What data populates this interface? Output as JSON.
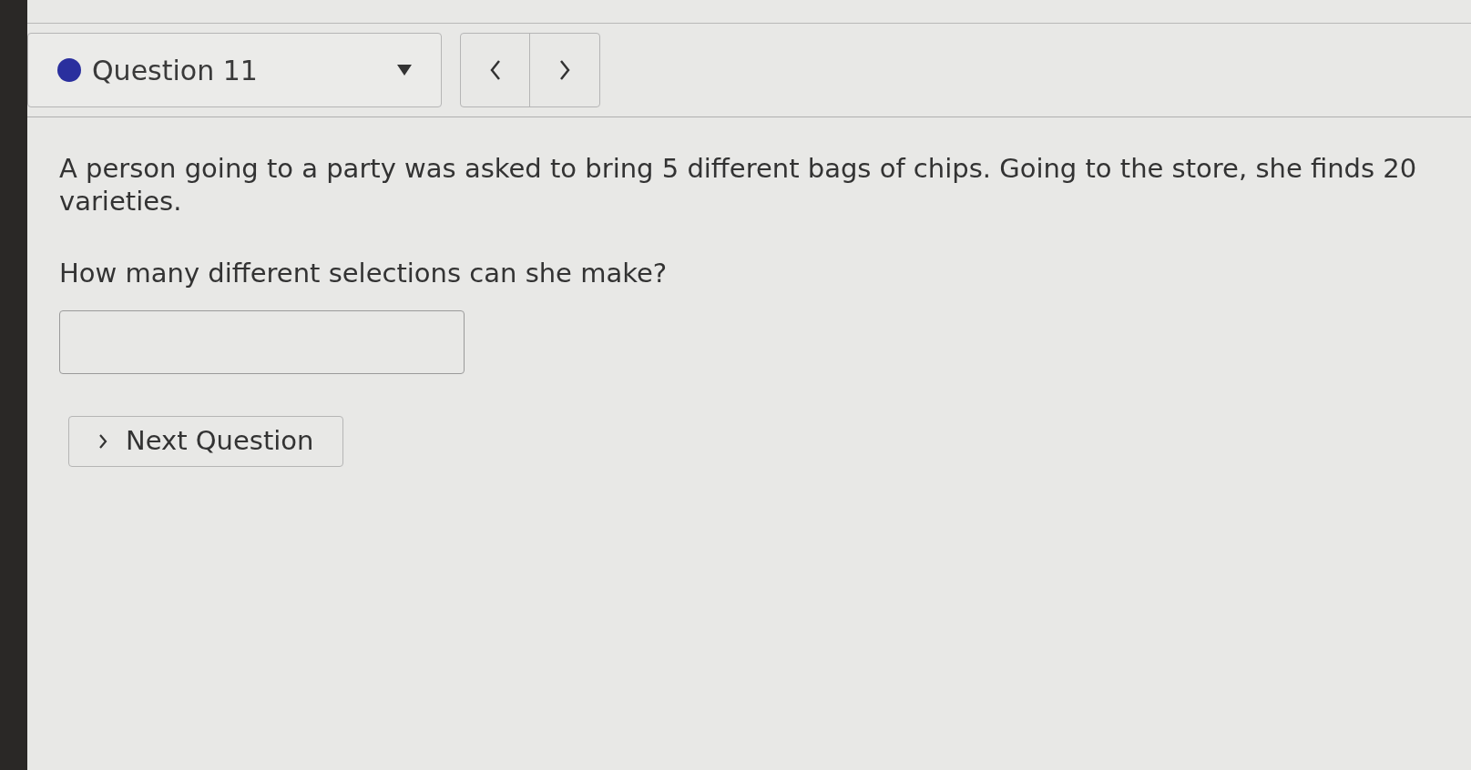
{
  "question_selector": {
    "label": "Question 11"
  },
  "question": {
    "text": "A person going to a party was asked to bring 5 different bags of chips. Going to the store, she finds 20 varieties.",
    "prompt": "How many different selections can she make?"
  },
  "next_button": {
    "label": "Next Question"
  }
}
